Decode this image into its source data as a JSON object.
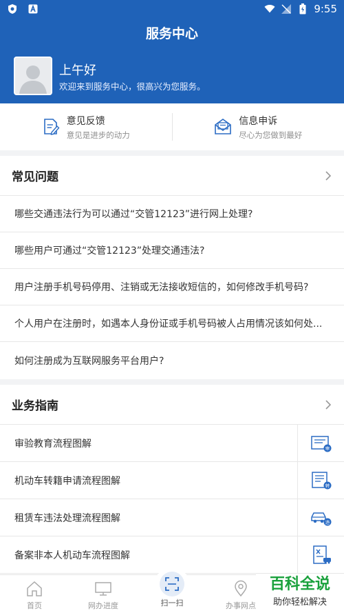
{
  "status_bar": {
    "time": "9:55"
  },
  "header": {
    "title": "服务中心",
    "greeting": "上午好",
    "welcome": "欢迎来到服务中心，很高兴为您服务。"
  },
  "quick_actions": [
    {
      "title": "意见反馈",
      "subtitle": "意见是进步的动力",
      "icon": "feedback-icon"
    },
    {
      "title": "信息申诉",
      "subtitle": "尽心为您做到最好",
      "icon": "mail-icon"
    }
  ],
  "faq": {
    "title": "常见问题",
    "items": [
      "哪些交通违法行为可以通过“交管12123”进行网上处理?",
      "哪些用户可通过“交管12123”处理交通违法?",
      "用户注册手机号码停用、注销或无法接收短信的，如何修改手机号码?",
      "个人用户在注册时，如遇本人身份证或手机号码被人占用情况该如何处...",
      "如何注册成为互联网服务平台用户?"
    ]
  },
  "guide": {
    "title": "业务指南",
    "items": [
      {
        "label": "审验教育流程图解",
        "icon": "document-review-icon",
        "badge": "审"
      },
      {
        "label": "机动车转籍申请流程图解",
        "icon": "document-transfer-icon",
        "badge": "转"
      },
      {
        "label": "租赁车违法处理流程图解",
        "icon": "car-violation-icon",
        "badge": "违"
      },
      {
        "label": "备案非本人机动车流程图解",
        "icon": "document-car-icon",
        "badge": ""
      }
    ]
  },
  "tab_bar": {
    "home": "首页",
    "progress": "网办进度",
    "scan": "扫一扫",
    "outlets": "办事网点"
  },
  "watermark": {
    "title": "百科全说",
    "subtitle": "助你轻松解决"
  },
  "colors": {
    "primary": "#1f62b8",
    "accent": "#2b6cc4",
    "watermark": "#1aa13c"
  }
}
